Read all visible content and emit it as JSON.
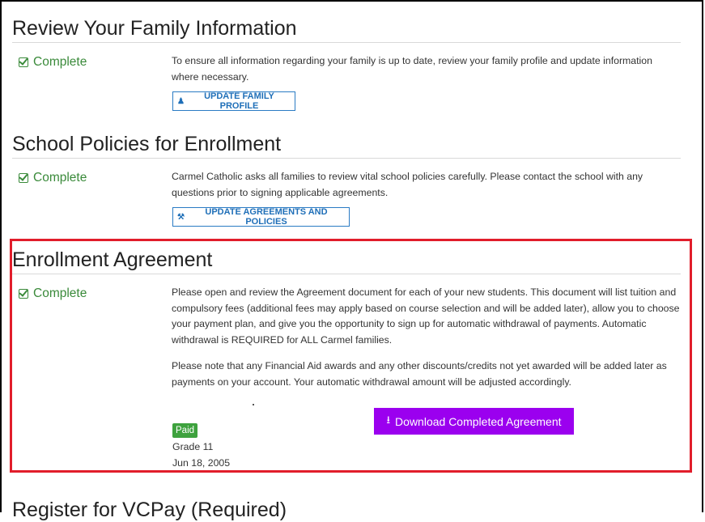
{
  "sections": [
    {
      "title": "Review Your Family Information",
      "status": "Complete",
      "description": "To ensure all information regarding your family is up to date, review your family profile and update information where necessary.",
      "button": "UPDATE FAMILY PROFILE"
    },
    {
      "title": "School Policies for Enrollment",
      "status": "Complete",
      "description": "Carmel Catholic asks all families to review vital school policies carefully. Please contact the school with any questions prior to signing applicable agreements.",
      "button": "UPDATE AGREEMENTS AND POLICIES"
    },
    {
      "title": "Enrollment Agreement",
      "status": "Complete",
      "paragraph1": "Please open and review the Agreement document for each of your new students. This document will list tuition and compulsory fees (additional fees may apply based on course selection and will be added later), allow you to choose your payment plan, and give you the opportunity to sign up for automatic withdrawal of payments. Automatic withdrawal is REQUIRED for ALL Carmel families.",
      "paragraph2": "Please note that any Financial Aid awards and any other discounts/credits not yet awarded will be added later as payments on your account. Your automatic withdrawal amount will be adjusted accordingly.",
      "badge": "Paid",
      "grade": "Grade 11",
      "date": "Jun 18, 2005",
      "download_button": "Download Completed Agreement"
    }
  ],
  "next_section_title": "Register for VCPay (Required)",
  "colors": {
    "complete_green": "#3a8a3a",
    "outline_blue": "#2a7bc4",
    "download_purple": "#9b00ef",
    "highlight_red": "#e11d2b",
    "paid_green": "#3ea23e"
  }
}
